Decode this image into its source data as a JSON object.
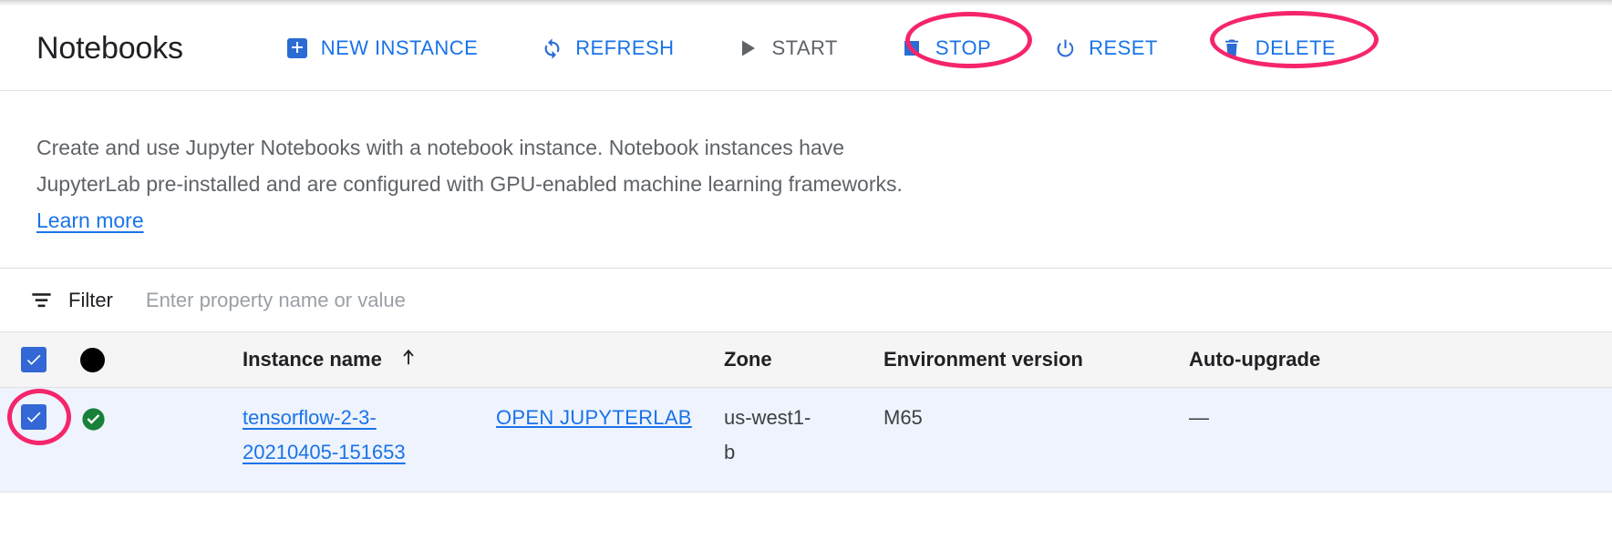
{
  "header": {
    "title": "Notebooks",
    "buttons": [
      {
        "label": "NEW INSTANCE",
        "icon": "plus-box-icon",
        "state": "enabled"
      },
      {
        "label": "REFRESH",
        "icon": "refresh-icon",
        "state": "enabled"
      },
      {
        "label": "START",
        "icon": "play-icon",
        "state": "disabled"
      },
      {
        "label": "STOP",
        "icon": "stop-square-icon",
        "state": "enabled"
      },
      {
        "label": "RESET",
        "icon": "power-icon",
        "state": "enabled"
      },
      {
        "label": "DELETE",
        "icon": "trash-icon",
        "state": "enabled"
      }
    ]
  },
  "description": {
    "text": "Create and use Jupyter Notebooks with a notebook instance. Notebook instances have JupyterLab pre-installed and are configured with GPU-enabled machine learning frameworks. ",
    "link_label": "Learn more"
  },
  "filter": {
    "icon": "filter-icon",
    "label": "Filter",
    "placeholder": "Enter property name or value",
    "value": ""
  },
  "table": {
    "header": {
      "select_all_icon": "checkbox-checked-icon",
      "status_icon": "status-circle-icon",
      "columns": [
        {
          "label": "Instance name",
          "sort_icon": "sort-arrow-up-icon"
        },
        {
          "label": "Zone"
        },
        {
          "label": "Environment version"
        },
        {
          "label": "Auto-upgrade"
        }
      ]
    },
    "rows": [
      {
        "selected": true,
        "row_checkbox_icon": "checkbox-checked-icon",
        "status_icon": "check-circle-green-icon",
        "instance_name_line1": "tensorflow-2-3-",
        "instance_name_line2": "20210405-151653",
        "open_action": "OPEN JUPYTERLAB",
        "zone_line1": "us-west1-",
        "zone_line2": "b",
        "environment_version": "M65",
        "auto_upgrade": "—"
      }
    ]
  },
  "annotations": {
    "color": "#f5256b",
    "targets": [
      "stop-button",
      "delete-button",
      "row-checkbox"
    ]
  },
  "colors": {
    "accent_blue": "#1a73e8",
    "checkbox_blue": "#3367d6",
    "status_green": "#188038",
    "annotation_pink": "#f5256b",
    "row_selected_bg": "#eef3fd",
    "header_bg": "#f5f5f5",
    "disabled_gray": "#5f6368"
  }
}
